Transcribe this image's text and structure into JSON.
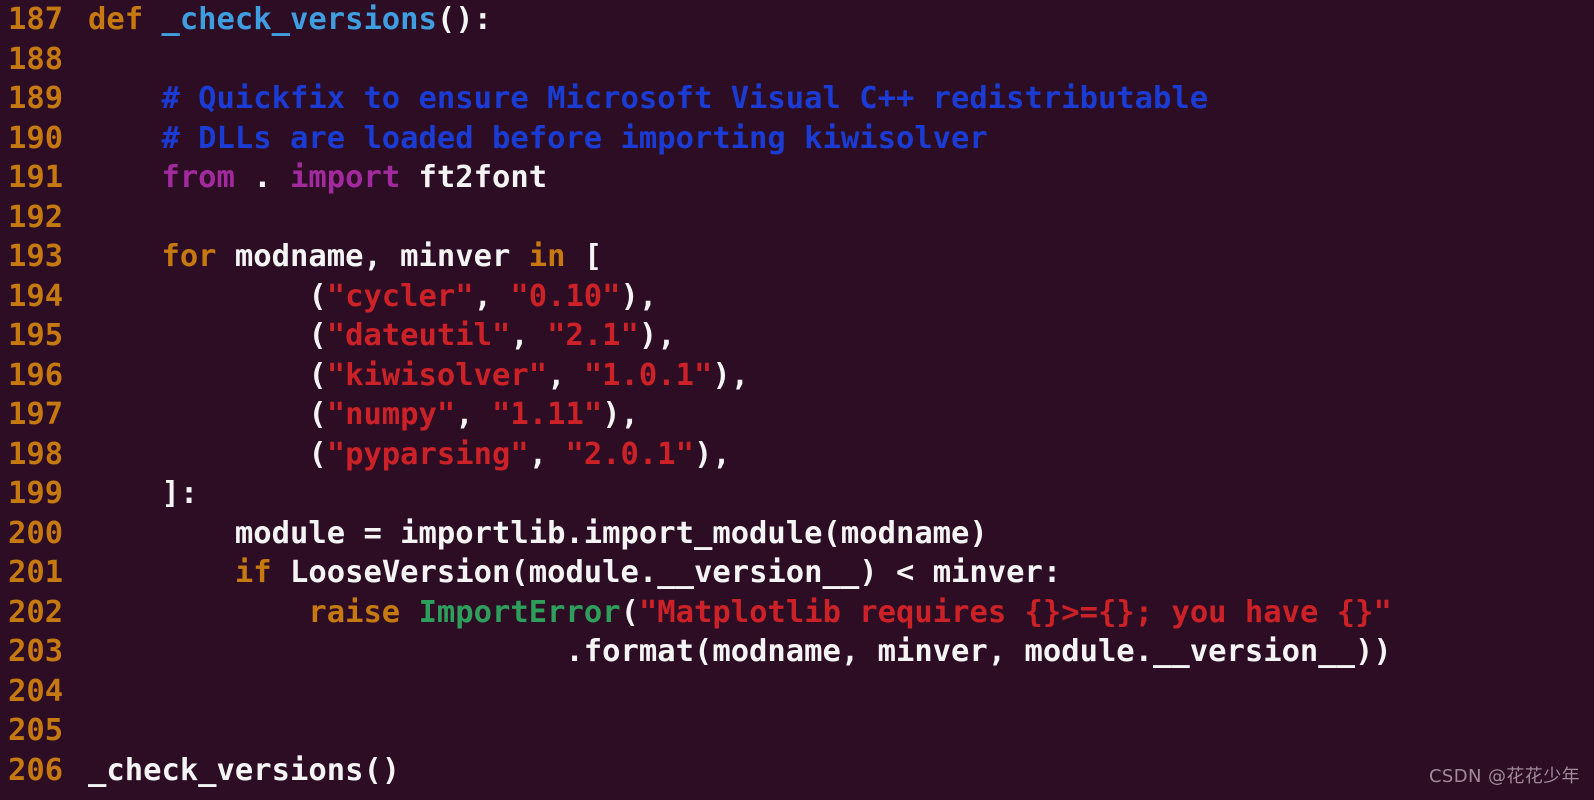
{
  "editor": {
    "language": "python",
    "background_color": "#2c0d24",
    "line_number_color": "#c6790f",
    "default_text_color": "#f4f4f4",
    "colors": {
      "keyword": "#c6790f",
      "function_name": "#3f9ee0",
      "comment": "#1a3cd5",
      "import_keyword": "#a32a9e",
      "string": "#cc2127",
      "exception": "#2e9e5b",
      "plain": "#f4f4f4"
    },
    "first_line_number": 187,
    "last_line_number": 206,
    "lines": [
      {
        "number": "187",
        "tokens": [
          {
            "text": "def ",
            "kind": "keyword"
          },
          {
            "text": "_check_versions",
            "kind": "function_name"
          },
          {
            "text": "():",
            "kind": "plain"
          }
        ]
      },
      {
        "number": "188",
        "tokens": []
      },
      {
        "number": "189",
        "tokens": [
          {
            "text": "    # Quickfix to ensure Microsoft Visual C++ redistributable",
            "kind": "comment"
          }
        ]
      },
      {
        "number": "190",
        "tokens": [
          {
            "text": "    # DLLs are loaded before importing kiwisolver",
            "kind": "comment"
          }
        ]
      },
      {
        "number": "191",
        "tokens": [
          {
            "text": "    ",
            "kind": "plain"
          },
          {
            "text": "from",
            "kind": "import_keyword"
          },
          {
            "text": " . ",
            "kind": "plain"
          },
          {
            "text": "import",
            "kind": "import_keyword"
          },
          {
            "text": " ft2font",
            "kind": "plain"
          }
        ]
      },
      {
        "number": "192",
        "tokens": []
      },
      {
        "number": "193",
        "tokens": [
          {
            "text": "    ",
            "kind": "plain"
          },
          {
            "text": "for",
            "kind": "keyword"
          },
          {
            "text": " modname, minver ",
            "kind": "plain"
          },
          {
            "text": "in",
            "kind": "keyword"
          },
          {
            "text": " [",
            "kind": "plain"
          }
        ]
      },
      {
        "number": "194",
        "tokens": [
          {
            "text": "            (",
            "kind": "plain"
          },
          {
            "text": "\"cycler\"",
            "kind": "string"
          },
          {
            "text": ", ",
            "kind": "plain"
          },
          {
            "text": "\"0.10\"",
            "kind": "string"
          },
          {
            "text": "),",
            "kind": "plain"
          }
        ]
      },
      {
        "number": "195",
        "tokens": [
          {
            "text": "            (",
            "kind": "plain"
          },
          {
            "text": "\"dateutil\"",
            "kind": "string"
          },
          {
            "text": ", ",
            "kind": "plain"
          },
          {
            "text": "\"2.1\"",
            "kind": "string"
          },
          {
            "text": "),",
            "kind": "plain"
          }
        ]
      },
      {
        "number": "196",
        "tokens": [
          {
            "text": "            (",
            "kind": "plain"
          },
          {
            "text": "\"kiwisolver\"",
            "kind": "string"
          },
          {
            "text": ", ",
            "kind": "plain"
          },
          {
            "text": "\"1.0.1\"",
            "kind": "string"
          },
          {
            "text": "),",
            "kind": "plain"
          }
        ]
      },
      {
        "number": "197",
        "tokens": [
          {
            "text": "            (",
            "kind": "plain"
          },
          {
            "text": "\"numpy\"",
            "kind": "string"
          },
          {
            "text": ", ",
            "kind": "plain"
          },
          {
            "text": "\"1.11\"",
            "kind": "string"
          },
          {
            "text": "),",
            "kind": "plain"
          }
        ]
      },
      {
        "number": "198",
        "tokens": [
          {
            "text": "            (",
            "kind": "plain"
          },
          {
            "text": "\"pyparsing\"",
            "kind": "string"
          },
          {
            "text": ", ",
            "kind": "plain"
          },
          {
            "text": "\"2.0.1\"",
            "kind": "string"
          },
          {
            "text": "),",
            "kind": "plain"
          }
        ]
      },
      {
        "number": "199",
        "tokens": [
          {
            "text": "    ]:",
            "kind": "plain"
          }
        ]
      },
      {
        "number": "200",
        "tokens": [
          {
            "text": "        module = importlib.import_module(modname)",
            "kind": "plain"
          }
        ]
      },
      {
        "number": "201",
        "tokens": [
          {
            "text": "        ",
            "kind": "plain"
          },
          {
            "text": "if",
            "kind": "keyword"
          },
          {
            "text": " LooseVersion(module.__version__) < minver:",
            "kind": "plain"
          }
        ]
      },
      {
        "number": "202",
        "tokens": [
          {
            "text": "            ",
            "kind": "plain"
          },
          {
            "text": "raise",
            "kind": "keyword"
          },
          {
            "text": " ",
            "kind": "plain"
          },
          {
            "text": "ImportError",
            "kind": "exception"
          },
          {
            "text": "(",
            "kind": "plain"
          },
          {
            "text": "\"Matplotlib requires {}>={}; you have {}\"",
            "kind": "string"
          }
        ]
      },
      {
        "number": "203",
        "tokens": [
          {
            "text": "                          .format(modname, minver, module.__version__))",
            "kind": "plain"
          }
        ]
      },
      {
        "number": "204",
        "tokens": []
      },
      {
        "number": "205",
        "tokens": []
      },
      {
        "number": "206",
        "tokens": [
          {
            "text": "_check_versions()",
            "kind": "plain"
          }
        ]
      }
    ]
  },
  "watermark": {
    "text": "CSDN @花花少年"
  }
}
